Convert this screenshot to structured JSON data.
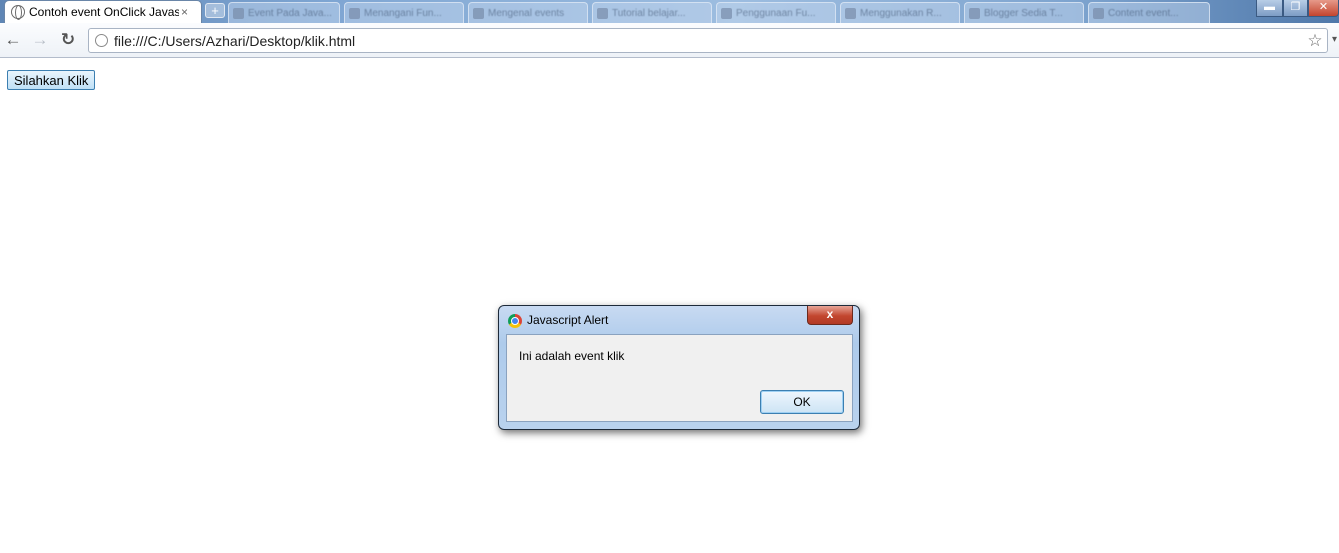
{
  "browser": {
    "active_tab": {
      "title": "Contoh event OnClick Javas",
      "close": "×"
    },
    "new_tab": "+",
    "background_tabs": [
      "Event Pada Java...",
      "Menangani Fun...",
      "Mengenal events",
      "Tutorial belajar...",
      "Penggunaan Fu...",
      "Menggunakan R...",
      "Blogger Sedia T...",
      "Content event..."
    ],
    "window_controls": {
      "minimize": "▬",
      "restore": "❐",
      "close": "✕"
    },
    "back": "←",
    "forward": "→",
    "reload": "↻",
    "url": "file:///C:/Users/Azhari/Desktop/klik.html",
    "bookmark_star": "☆",
    "menu": "▾"
  },
  "page": {
    "button_label": "Silahkan Klik"
  },
  "dialog": {
    "title": "Javascript Alert",
    "close": "x",
    "message": "Ini adalah event klik",
    "ok_label": "OK"
  },
  "colors": {
    "page_button_border": "#3c7fb1",
    "dialog_frame": "#aecbeb",
    "dialog_close": "#c2462f"
  }
}
